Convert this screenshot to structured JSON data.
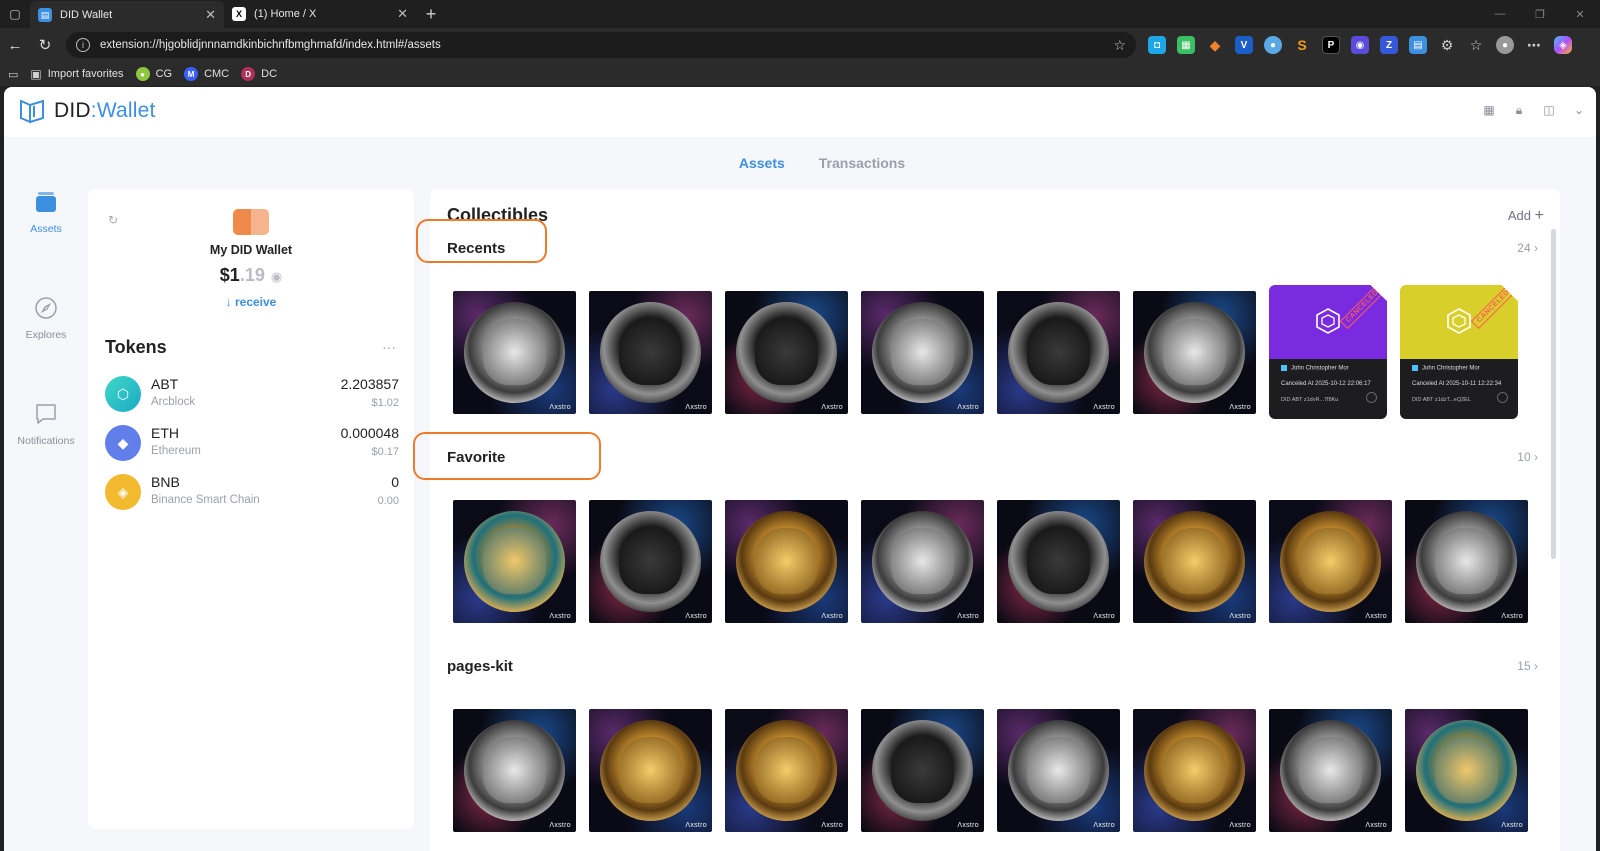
{
  "browser": {
    "tabs": [
      {
        "title": "DID Wallet",
        "active": true
      },
      {
        "title": "(1) Home / X",
        "active": false
      }
    ],
    "url": "extension://hjgoblidjnnnamdkinbichnfbmghmafd/index.html#/assets",
    "bookmarks": [
      {
        "label": "Import favorites",
        "icon": "folder-import-icon"
      },
      {
        "label": "CG",
        "icon": "coingecko-icon",
        "color": "#8dc63f"
      },
      {
        "label": "CMC",
        "icon": "coinmarketcap-icon",
        "color": "#3861fb"
      },
      {
        "label": "DC",
        "icon": "dc-icon",
        "color": "#b0305a"
      }
    ]
  },
  "app": {
    "logo": {
      "did": "DID",
      "sep": ":",
      "wallet": "Wallet"
    },
    "main_tabs": [
      {
        "label": "Assets",
        "active": true
      },
      {
        "label": "Transactions",
        "active": false
      }
    ],
    "sidenav": [
      {
        "label": "Assets",
        "icon": "wallet-stack-icon",
        "active": true
      },
      {
        "label": "Explores",
        "icon": "compass-icon",
        "active": false
      },
      {
        "label": "Notifications",
        "icon": "chat-bubble-icon",
        "active": false
      }
    ],
    "wallet": {
      "name": "My DID Wallet",
      "balance_main": "$1",
      "balance_cents": ".19",
      "receive_label": "receive"
    },
    "tokens": {
      "title": "Tokens",
      "items": [
        {
          "symbol": "ABT",
          "network": "Arcblock",
          "amount": "2.203857",
          "usd": "$1.02",
          "color": "#24c7c1"
        },
        {
          "symbol": "ETH",
          "network": "Ethereum",
          "amount": "0.000048",
          "usd": "$0.17",
          "color": "#627eea"
        },
        {
          "symbol": "BNB",
          "network": "Binance Smart Chain",
          "amount": "0",
          "usd": "0.00",
          "color": "#f3ba2f"
        }
      ]
    },
    "collectibles": {
      "title": "Collectibles",
      "add_label": "Add",
      "nft_tag": "Λxstro",
      "sections": [
        {
          "title": "Recents",
          "count": "24"
        },
        {
          "title": "Favorite",
          "count": "10"
        },
        {
          "title": "pages-kit",
          "count": "15"
        }
      ],
      "tickets": [
        {
          "holder": "John Christopher Mor",
          "canceled_label": "Canceled At",
          "canceled_at": "2025-10-12 22:06:17",
          "footer": "DID ABT  z1dvR...7f8Ku",
          "stamp": "CANCELED",
          "color": "#7a2be0"
        },
        {
          "holder": "John Christopher Mor",
          "canceled_label": "Canceled At",
          "canceled_at": "2025-10-11 12:22:34",
          "footer": "DID ABT  z1dzT...eQ2EL",
          "stamp": "CANCELED",
          "color": "#d9cf2a"
        }
      ]
    }
  },
  "colors": {
    "accent": "#3d8fe0",
    "highlight": "#ee7a2b"
  }
}
